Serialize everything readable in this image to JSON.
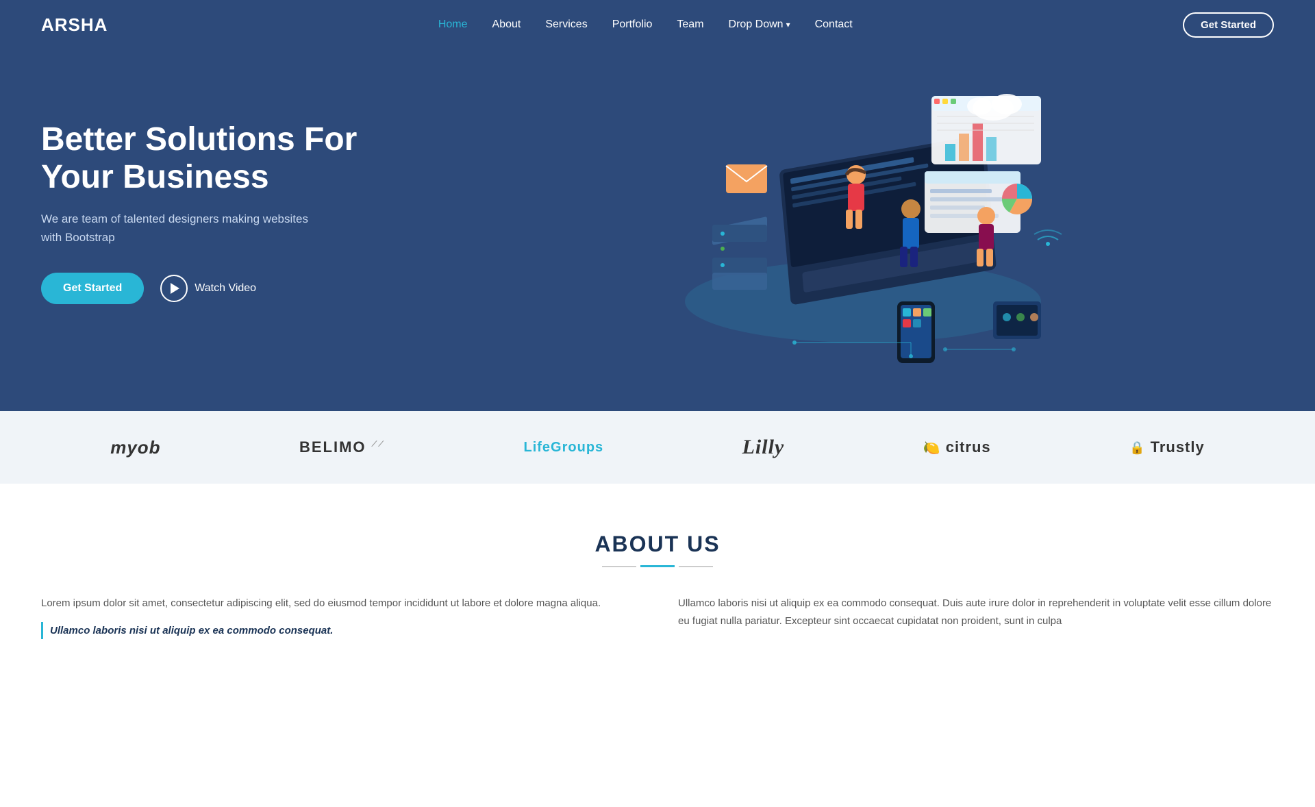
{
  "brand": "ARSHA",
  "nav": {
    "items": [
      {
        "label": "Home",
        "active": true
      },
      {
        "label": "About",
        "active": false
      },
      {
        "label": "Services",
        "active": false
      },
      {
        "label": "Portfolio",
        "active": false
      },
      {
        "label": "Team",
        "active": false
      },
      {
        "label": "Drop Down",
        "active": false,
        "dropdown": true
      },
      {
        "label": "Contact",
        "active": false
      }
    ],
    "cta_label": "Get Started"
  },
  "hero": {
    "title_line1": "Better Solutions For",
    "title_line2": "Your Business",
    "subtitle": "We are team of talented designers making websites\nwith Bootstrap",
    "cta_label": "Get Started",
    "watch_label": "Watch Video"
  },
  "clients": [
    {
      "name": "myob",
      "label": "myob"
    },
    {
      "name": "belimo",
      "label": "BELIMO"
    },
    {
      "name": "lifegroups",
      "label": "LifeGroups"
    },
    {
      "name": "lilly",
      "label": "Lilly"
    },
    {
      "name": "citrus",
      "label": "citrus"
    },
    {
      "name": "trustly",
      "label": "Trustly"
    }
  ],
  "about": {
    "title": "ABOUT US",
    "col1_p1": "Lorem ipsum dolor sit amet, consectetur adipiscing elit, sed do eiusmod tempor incididunt ut labore et dolore magna aliqua.",
    "col1_p2": "Ullamco laboris nisi ut aliquip ex ea commodo consequat.",
    "col2_p1": "Ullamco laboris nisi ut aliquip ex ea commodo consequat. Duis aute irure dolor in reprehenderit in voluptate velit esse cillum dolore eu fugiat nulla pariatur. Excepteur sint occaecat cupidatat non proident, sunt in culpa",
    "col2_p2": ""
  },
  "colors": {
    "hero_bg": "#2d4a7a",
    "accent": "#29b6d6",
    "nav_active": "#29b6d6",
    "text_dark": "#1a3355"
  }
}
